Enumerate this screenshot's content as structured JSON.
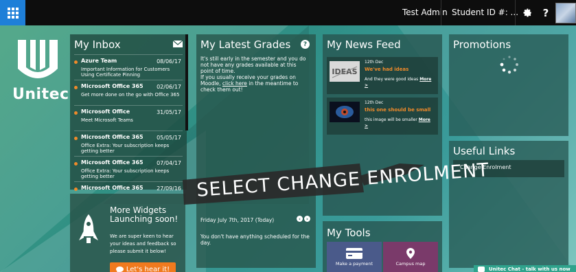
{
  "topbar": {
    "user_name": "Test Admin",
    "student_id": "Student ID #: ..."
  },
  "logo": {
    "text": "Unitec"
  },
  "inbox": {
    "title": "My Inbox",
    "items": [
      {
        "sender": "Azure Team",
        "date": "08/06/17",
        "subject": "Important Information for Customers Using Certificate Pinning"
      },
      {
        "sender": "Microsoft Office 365",
        "date": "02/06/17",
        "subject": "Get more done on the go with Office 365"
      },
      {
        "sender": "Microsoft Office",
        "date": "31/05/17",
        "subject": "Meet Microsoft Teams"
      },
      {
        "sender": "Microsoft Office 365",
        "date": "05/05/17",
        "subject": "Office Extra: Your subscription keeps getting better"
      },
      {
        "sender": "Microsoft Office 365",
        "date": "07/04/17",
        "subject": "Office Extra: Your subscription keeps getting better"
      },
      {
        "sender": "Microsoft Office 365",
        "date": "27/09/16",
        "subject": ""
      }
    ]
  },
  "widgets": {
    "title": "More Widgets Launching soon!",
    "text": "We are super keen to hear your ideas and feedback so please submit it below!",
    "button": "Let's hear it!"
  },
  "grades": {
    "title": "My Latest Grades",
    "text_1": "It's still early in the semester and you do not have any grades available at this point of time.",
    "text_2": "If you usually receive your grades on Moodle, ",
    "link": "click here",
    "text_3": " in the meantime to check them out!"
  },
  "calendar": {
    "date": "Friday July 7th, 2017 (Today)",
    "empty": "You don't have anything scheduled for the day."
  },
  "news": {
    "title": "My News Feed",
    "items": [
      {
        "date": "12th Dec",
        "title": "We've had ideas",
        "desc": "And they were good ideas ",
        "more": "More",
        "arrow": ">"
      },
      {
        "date": "12th Dec",
        "title": "this one should be small",
        "desc": "this image will be smaller ",
        "more": "More",
        "arrow": ">"
      }
    ]
  },
  "tools": {
    "title": "My Tools",
    "pay": "Make a payment",
    "map": "Campus map"
  },
  "promos": {
    "title": "Promotions"
  },
  "links": {
    "title": "Useful Links",
    "item": "Change Enrolment"
  },
  "annotation": {
    "text": "SELECT CHANGE ENROLMENT"
  },
  "chat": {
    "label": "Unitec Chat - talk with us now"
  },
  "colors": {
    "accent": "#1e7fd8",
    "orange": "#f08a2a",
    "chat": "#2fa38c"
  }
}
